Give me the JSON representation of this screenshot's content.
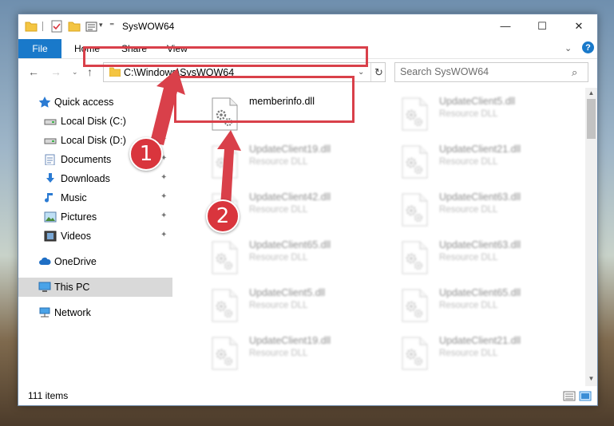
{
  "window": {
    "title": "SysWOW64",
    "controls": {
      "minimize": "—",
      "maximize": "☐",
      "close": "✕"
    }
  },
  "ribbon": {
    "file": "File",
    "home": "Home",
    "share": "Share",
    "view": "View",
    "help": "?"
  },
  "nav": {
    "back": "←",
    "forward": "→",
    "recent": "⌄",
    "up": "↑",
    "address": "C:\\Windows\\SysWOW64",
    "address_dropdown": "⌄",
    "refresh": "↻",
    "search_placeholder": "Search SysWOW64",
    "search_icon": "⌕"
  },
  "sidebar": {
    "items": [
      {
        "label": "Quick access",
        "icon": "star-icon"
      },
      {
        "label": "Local Disk (C:)",
        "icon": "drive-icon",
        "pinned": true
      },
      {
        "label": "Local Disk (D:)",
        "icon": "drive-icon",
        "pinned": true
      },
      {
        "label": "Documents",
        "icon": "documents-icon",
        "pinned": true
      },
      {
        "label": "Downloads",
        "icon": "download-icon",
        "pinned": true
      },
      {
        "label": "Music",
        "icon": "music-icon",
        "pinned": true
      },
      {
        "label": "Pictures",
        "icon": "pictures-icon",
        "pinned": true
      },
      {
        "label": "Videos",
        "icon": "videos-icon",
        "pinned": true
      },
      {
        "label": "OneDrive",
        "icon": "cloud-icon"
      },
      {
        "label": "This PC",
        "icon": "computer-icon",
        "selected": true
      },
      {
        "label": "Network",
        "icon": "network-icon"
      }
    ],
    "pin_glyph": "📌"
  },
  "files": [
    {
      "name": "memberinfo.dll",
      "type": ""
    },
    {
      "name": "UpdateClient5.dll",
      "type": "Resource DLL"
    },
    {
      "name": "UpdateClient19.dll",
      "type": "Resource DLL"
    },
    {
      "name": "UpdateClient21.dll",
      "type": "Resource DLL"
    },
    {
      "name": "UpdateClient42.dll",
      "type": "Resource DLL"
    },
    {
      "name": "UpdateClient63.dll",
      "type": "Resource DLL"
    },
    {
      "name": "UpdateClient65.dll",
      "type": "Resource DLL"
    },
    {
      "name": "UpdateClient63.dll",
      "type": "Resource DLL"
    },
    {
      "name": "UpdateClient5.dll",
      "type": "Resource DLL"
    },
    {
      "name": "UpdateClient65.dll",
      "type": "Resource DLL"
    },
    {
      "name": "UpdateClient19.dll",
      "type": "Resource DLL"
    },
    {
      "name": "UpdateClient21.dll",
      "type": "Resource DLL"
    }
  ],
  "status": {
    "count": "111 items"
  },
  "annotations": {
    "step1": "1",
    "step2": "2",
    "highlight_color": "#d9404a"
  },
  "colors": {
    "accent": "#1979ca",
    "selected_bg": "#d9d9d9"
  }
}
